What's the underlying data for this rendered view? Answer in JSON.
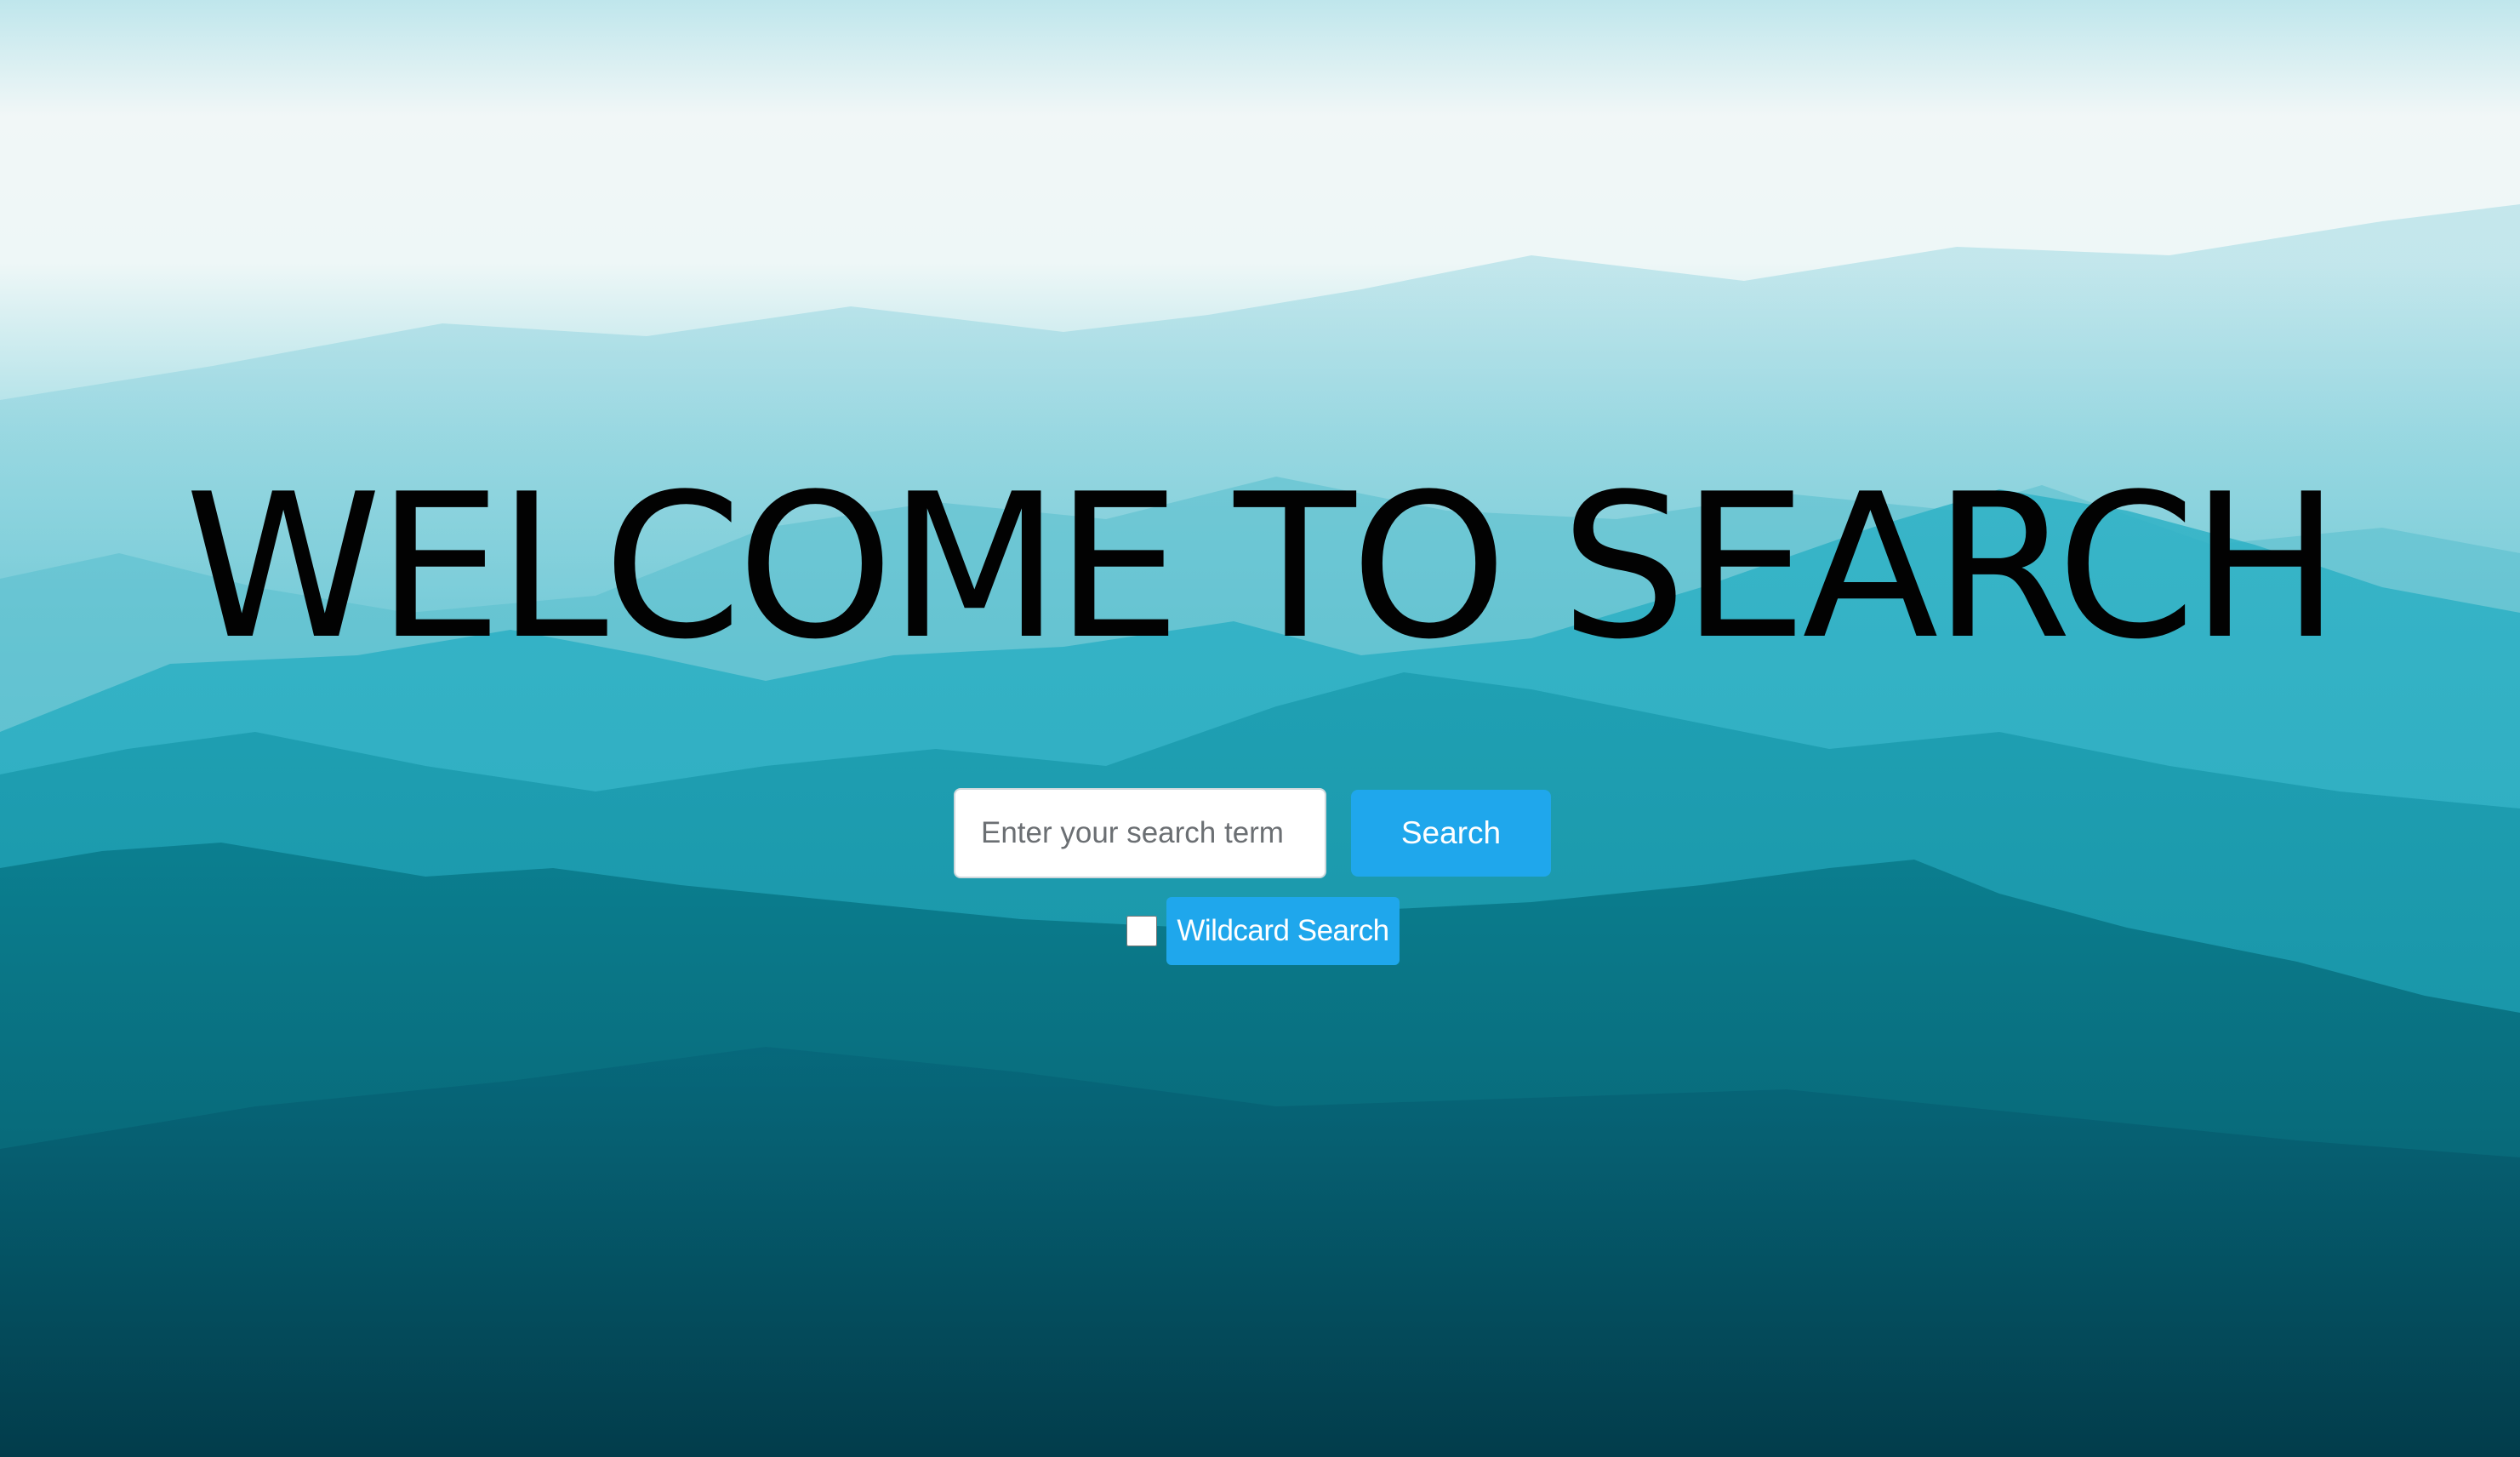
{
  "page": {
    "title": "WELCOME TO SEARCH",
    "background": "misty-teal-mountains"
  },
  "search": {
    "placeholder": "Enter your search term",
    "value": "",
    "button_label": "Search"
  },
  "wildcard": {
    "checked": false,
    "label": "Wildcard Search"
  },
  "colors": {
    "accent": "#1fa7ec",
    "title": "#020202",
    "sky_top": "#f4f8f8",
    "mountain_dark": "#023a48"
  }
}
